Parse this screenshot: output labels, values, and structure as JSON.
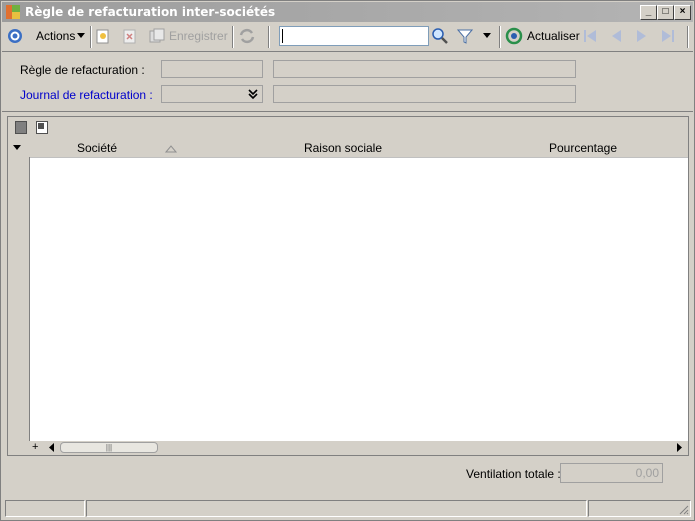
{
  "window": {
    "title": "Règle de refacturation inter-sociétés",
    "minimize": "_",
    "maximize": "□",
    "close": "×"
  },
  "toolbar": {
    "actions_label": "Actions",
    "save_label": "Enregistrer",
    "search_value": "",
    "refresh_label": "Actualiser"
  },
  "form": {
    "rule_label": "Règle de refacturation :",
    "rule_code": "",
    "rule_description": "",
    "journal_label": "Journal de refacturation :",
    "journal_code": "",
    "journal_description": ""
  },
  "grid": {
    "columns": [
      "Société",
      "Raison sociale",
      "Pourcentage"
    ],
    "rows": [],
    "add_symbol": "+",
    "thumb_grip": "|||"
  },
  "footer": {
    "total_label": "Ventilation totale :",
    "total_value": "0,00"
  },
  "colors": {
    "link_label": "#0000cc",
    "window_bg": "#d4d0c8"
  }
}
